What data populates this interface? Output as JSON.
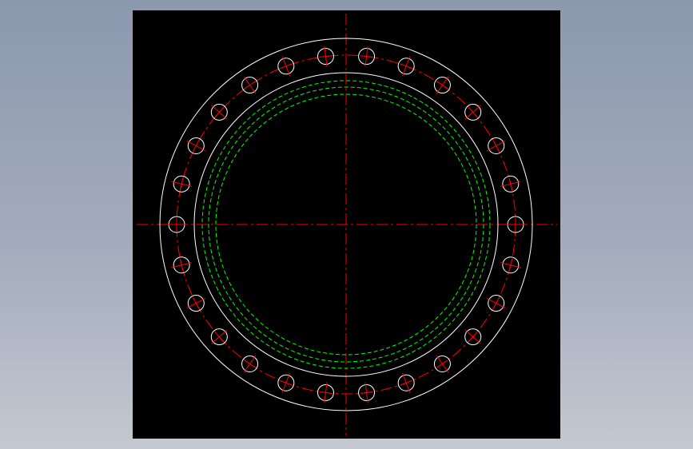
{
  "drawing": {
    "background_color": "#000000",
    "page_background": [
      "#8b98ae",
      "#c4c8d1"
    ],
    "colors": {
      "outline": "#ffffff",
      "centerline": "#ff0000",
      "hidden": "#00ff00"
    },
    "bolt_hole_count": 26,
    "line_types": {
      "outline": "continuous",
      "centerline": "dash-dot",
      "hidden": "dashed"
    }
  }
}
